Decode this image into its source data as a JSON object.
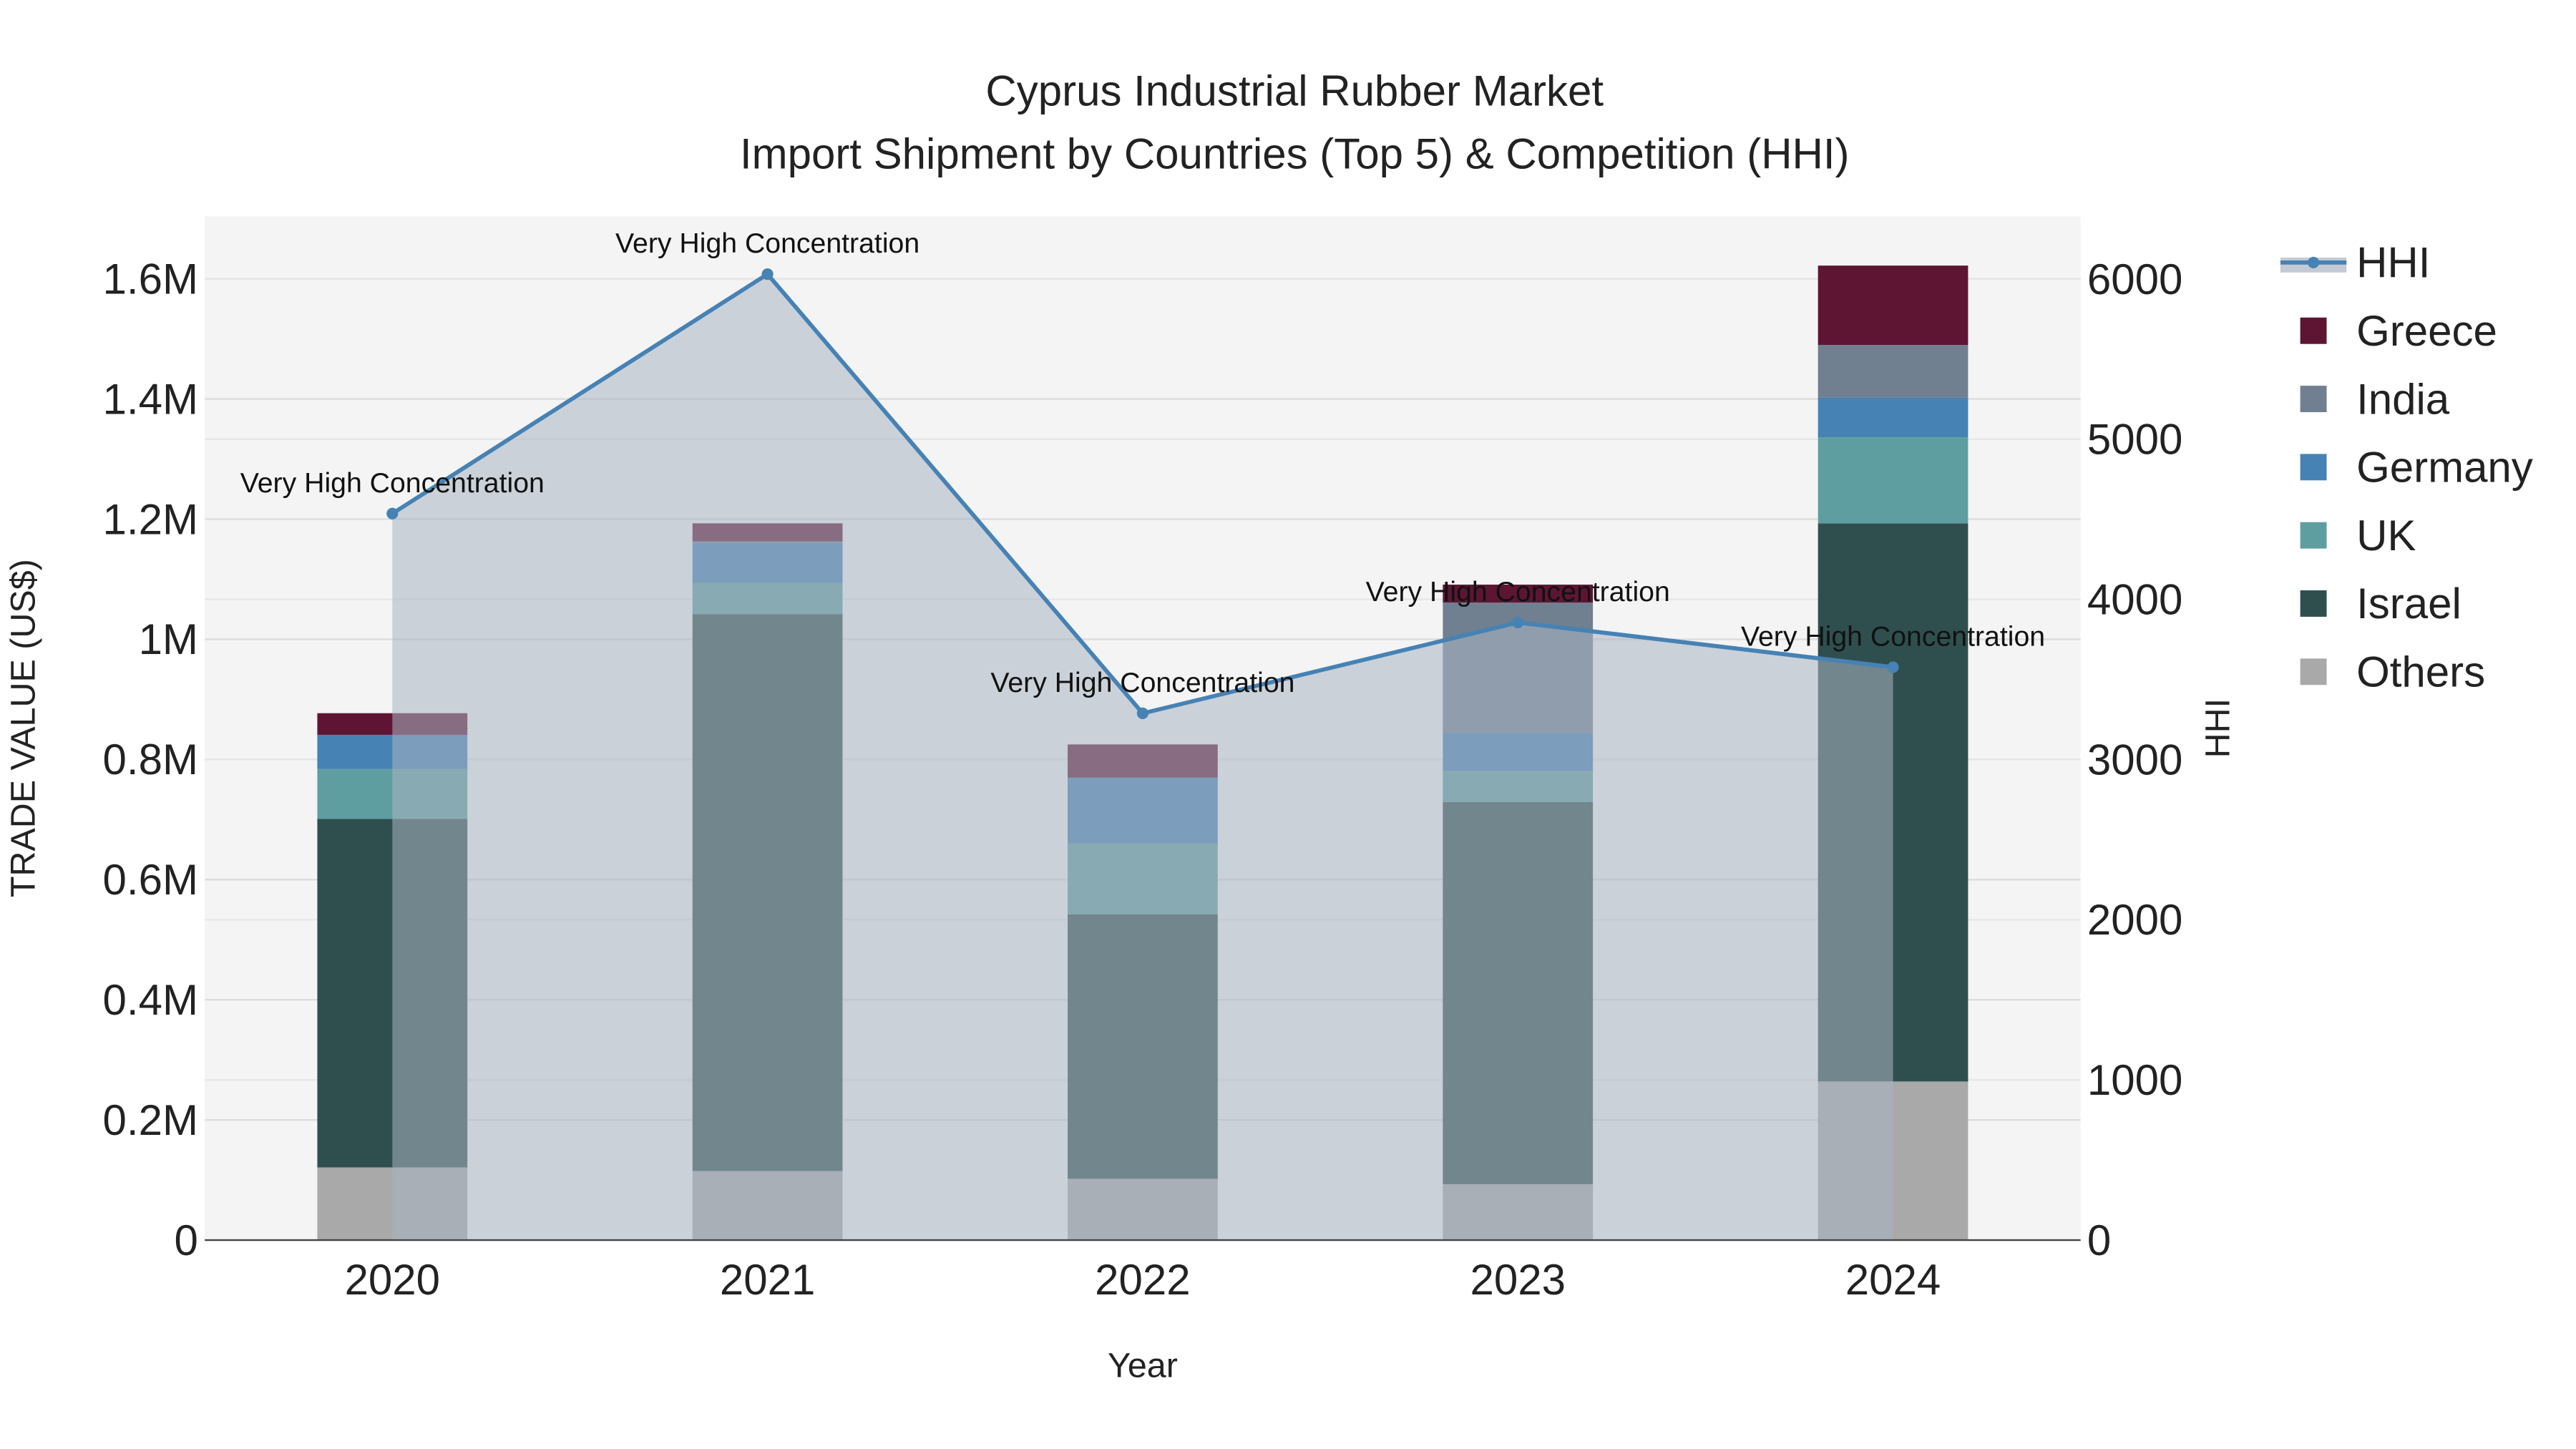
{
  "chart_data": {
    "type": "bar",
    "title": "Cyprus Industrial Rubber Market",
    "subtitle": "Import Shipment by Countries (Top 5) & Competition (HHI)",
    "xlabel": "Year",
    "ylabel": "TRADE VALUE (US$)",
    "y2label": "HHI",
    "categories": [
      "2020",
      "2021",
      "2022",
      "2023",
      "2024"
    ],
    "ylim": [
      0,
      1704000
    ],
    "y2lim": [
      0,
      6392
    ],
    "yticks": [
      0,
      200000,
      400000,
      600000,
      800000,
      1000000,
      1200000,
      1400000,
      1600000
    ],
    "ytick_labels": [
      "0",
      "0.2M",
      "0.4M",
      "0.6M",
      "0.8M",
      "1M",
      "1.2M",
      "1.4M",
      "1.6M"
    ],
    "y2ticks": [
      0,
      1000,
      2000,
      3000,
      4000,
      5000,
      6000
    ],
    "y2tick_labels": [
      "0",
      "1000",
      "2000",
      "3000",
      "4000",
      "5000",
      "6000"
    ],
    "grid": true,
    "legend_position": "right",
    "stacked": true,
    "series": [
      {
        "name": "Others",
        "color": "#a9a9a9",
        "values": [
          121000,
          115000,
          102000,
          93000,
          264000
        ]
      },
      {
        "name": "Israel",
        "color": "#2f4f4f",
        "values": [
          580000,
          927000,
          440000,
          636000,
          929000
        ]
      },
      {
        "name": "UK",
        "color": "#5f9ea0",
        "values": [
          83000,
          52000,
          118000,
          52000,
          143000
        ]
      },
      {
        "name": "Germany",
        "color": "#4682b4",
        "values": [
          57000,
          66000,
          110000,
          63000,
          66000
        ]
      },
      {
        "name": "India",
        "color": "#708090",
        "values": [
          0,
          3000,
          0,
          217000,
          88000
        ]
      },
      {
        "name": "Greece",
        "color": "#5e1533",
        "values": [
          36000,
          30000,
          55000,
          30000,
          132000
        ]
      }
    ],
    "legend_order": [
      "HHI",
      "Greece",
      "India",
      "Germany",
      "UK",
      "Israel",
      "Others"
    ],
    "hhi": {
      "name": "HHI",
      "color": "#4682b4",
      "values": [
        4536,
        6031,
        3289,
        3856,
        3577
      ],
      "annotations": [
        "Very High Concentration",
        "Very High Concentration",
        "Very High Concentration",
        "Very High Concentration",
        "Very High Concentration"
      ]
    }
  }
}
